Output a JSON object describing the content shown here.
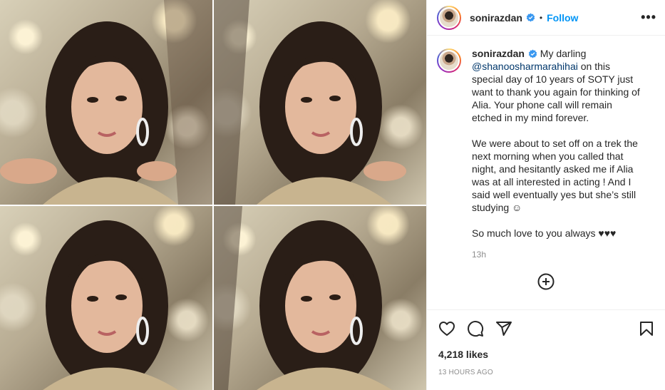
{
  "post": {
    "username": "sonirazdan",
    "follow_label": "Follow",
    "dot": "•",
    "more_label": "•••",
    "caption": {
      "username": "sonirazdan",
      "lead": " My darling ",
      "mention": "@shanoosharmarahihai",
      "rest": " on this special day of 10 years of SOTY just want to thank you again for thinking of Alia. Your phone call will remain etched in my mind forever.",
      "para2": "We were about to set off on a trek the next morning when you called that night, and hesitantly asked me if Alia was at all interested in acting ! And I said well eventually yes but she’s still studying ☺",
      "para3": "So much love to you always ♥♥♥"
    },
    "caption_time": "13h",
    "likes": "4,218 likes",
    "posted": "13 HOURS AGO"
  },
  "icons": {
    "verified": "verified-badge-icon",
    "more": "more-options-icon",
    "add_comment": "plus-circle-icon",
    "like": "heart-icon",
    "comment": "comment-icon",
    "share": "paper-plane-icon",
    "save": "bookmark-icon"
  },
  "colors": {
    "link": "#0095f6",
    "mention": "#00376b",
    "muted": "#8e8e8e",
    "text": "#262626"
  }
}
